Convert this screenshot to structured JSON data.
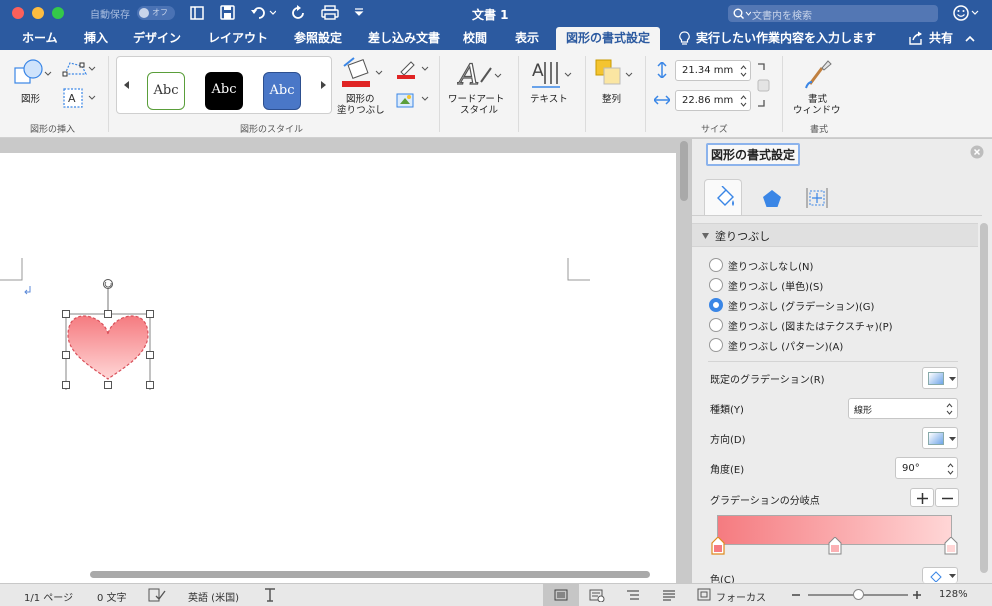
{
  "titlebar": {
    "autosave_label": "自動保存",
    "autosave_state": "オフ",
    "doc_title": "文書 1",
    "search_placeholder": "文書内を検索"
  },
  "tabs": [
    "ホーム",
    "挿入",
    "デザイン",
    "レイアウト",
    "参照設定",
    "差し込み文書",
    "校閲",
    "表示",
    "図形の書式設定"
  ],
  "active_tab": "図形の書式設定",
  "tell_me": "実行したい作業内容を入力します",
  "share": "共有",
  "ribbon": {
    "shape_button": "図形",
    "group_insert": "図形の挿入",
    "style_samples": [
      "Abc",
      "Abc",
      "Abc"
    ],
    "fill_label_1": "図形の",
    "fill_label_2": "塗りつぶし",
    "group_styles": "図形のスタイル",
    "wordart_1": "ワードアート",
    "wordart_2": "スタイル",
    "text_label": "テキスト",
    "arrange_label": "整列",
    "height_value": "21.34 mm",
    "width_value": "22.86 mm",
    "group_size": "サイズ",
    "format_pane_1": "書式",
    "format_pane_2": "ウィンドウ",
    "group_format": "書式"
  },
  "pane": {
    "title": "図形の書式設定",
    "section": "塗りつぶし",
    "options": [
      "塗りつぶしなし(N)",
      "塗りつぶし (単色)(S)",
      "塗りつぶし (グラデーション)(G)",
      "塗りつぶし (図またはテクスチャ)(P)",
      "塗りつぶし (パターン)(A)"
    ],
    "selected_index": 2,
    "preset_label": "既定のグラデーション(R)",
    "type_label": "種類(Y)",
    "type_value": "線形",
    "direction_label": "方向(D)",
    "angle_label": "角度(E)",
    "angle_value": "90°",
    "stops_label": "グラデーションの分岐点",
    "color_label": "色(C)"
  },
  "status": {
    "page": "1/1 ページ",
    "words": "0 文字",
    "language": "英語 (米国)",
    "focus": "フォーカス",
    "zoom": "128%"
  },
  "colors": {
    "accent": "#2c5aa0",
    "heart_top": "#f57b80",
    "heart_bottom": "#ffd6d6",
    "selected_radio": "#3a86e6"
  }
}
